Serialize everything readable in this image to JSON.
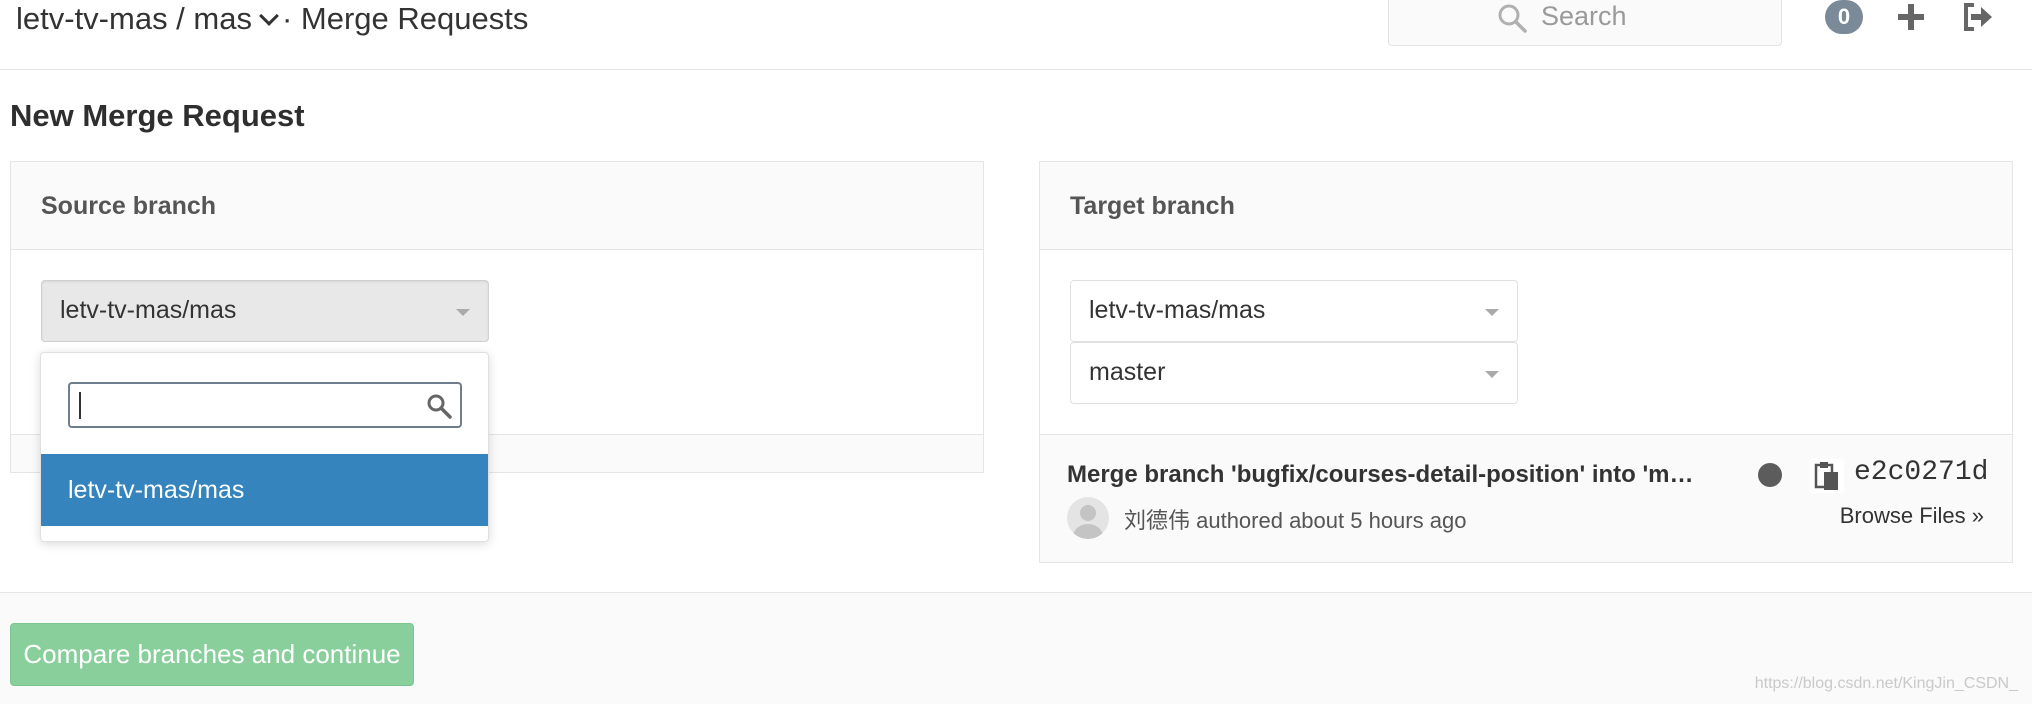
{
  "header": {
    "project": "letv-tv-mas / mas",
    "separator": "·",
    "section": "Merge Requests",
    "search_placeholder": "Search",
    "notification_count": "0",
    "icons": [
      "search-icon",
      "plus-icon",
      "sign-out-icon"
    ]
  },
  "page": {
    "title": "New Merge Request"
  },
  "source": {
    "heading": "Source branch",
    "project_select": "letv-tv-mas/mas",
    "dropdown": {
      "search_value": "",
      "options": [
        "letv-tv-mas/mas"
      ]
    }
  },
  "target": {
    "heading": "Target branch",
    "project_select": "letv-tv-mas/mas",
    "branch_select": "master",
    "commit": {
      "title": "Merge branch 'bugfix/courses-detail-position' into 'm…",
      "sha": "e2c0271d",
      "author_line": "刘德伟 authored about 5 hours ago",
      "browse_link": "Browse Files »"
    }
  },
  "footer": {
    "compare_button": "Compare branches and continue",
    "watermark": "https://blog.csdn.net/KingJin_CSDN_"
  },
  "colors": {
    "selected_option": "#3584bd",
    "compare_button": "#88cf9c",
    "badge": "#7a8a99"
  }
}
